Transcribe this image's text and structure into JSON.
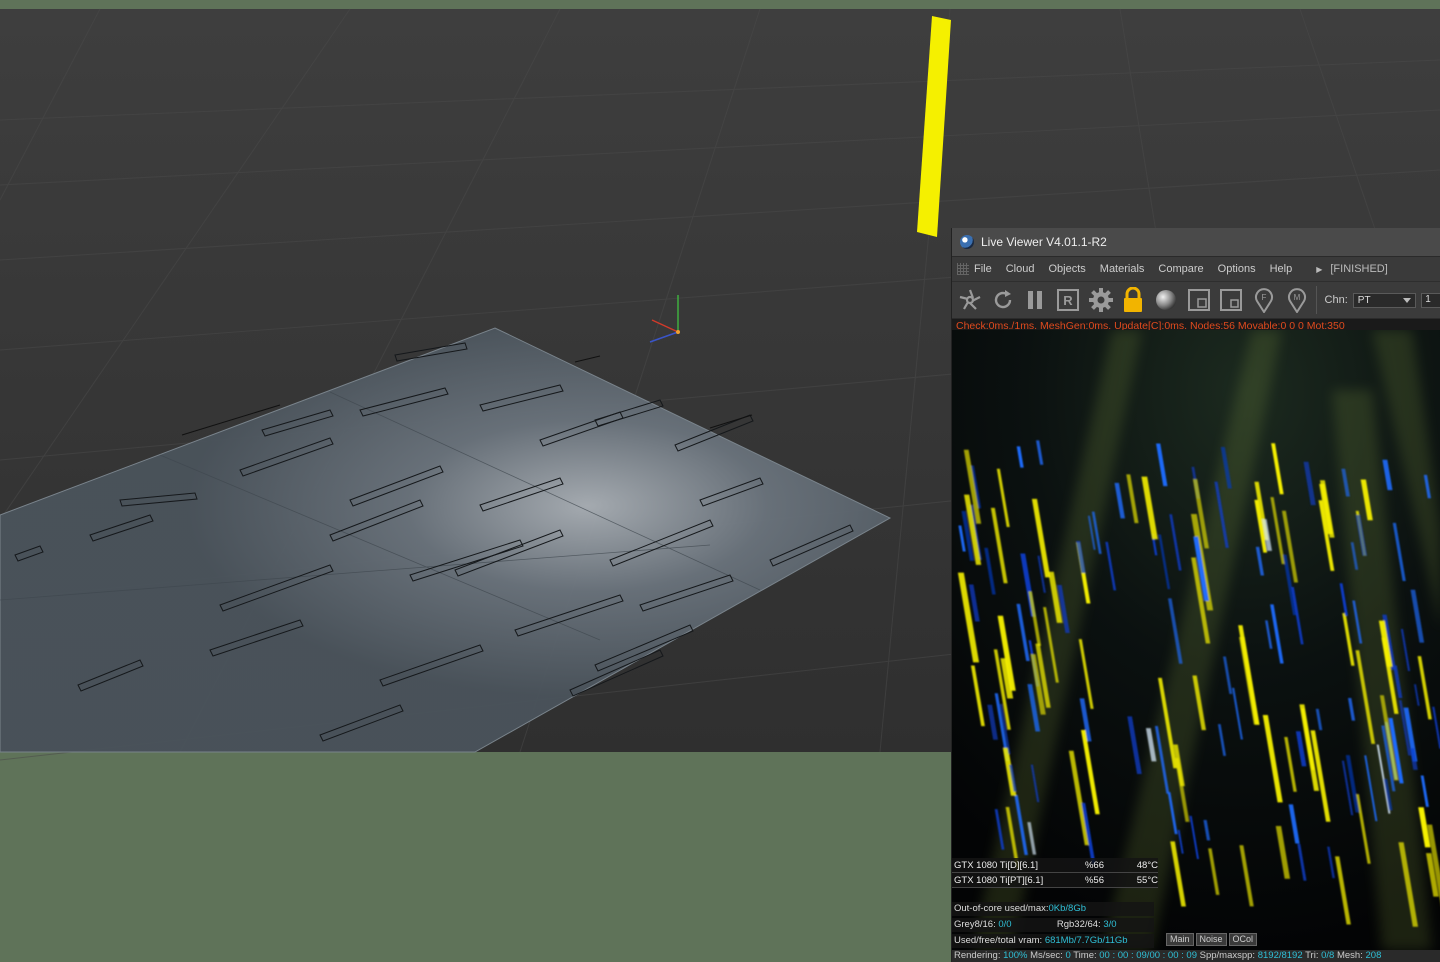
{
  "live_viewer": {
    "title": "Live Viewer V4.01.1-R2",
    "menu": [
      "File",
      "Cloud",
      "Objects",
      "Materials",
      "Compare",
      "Options",
      "Help"
    ],
    "render_state": "[FINISHED]",
    "toolbar": {
      "icons": [
        "send-scene-icon",
        "restart-icon",
        "pause-icon",
        "region-render-icon",
        "settings-gear-icon",
        "lock-icon",
        "material-sphere-icon",
        "clay-mode-icon",
        "subsample-icon",
        "focus-pick-icon",
        "material-pick-icon"
      ],
      "region_label": "R",
      "focus_label": "F",
      "material_label": "M",
      "channel_label": "Chn:",
      "channel_value": "PT",
      "next_value": "1"
    },
    "check_line": "Check:0ms./1ms. MeshGen:0ms. Update[C]:0ms. Nodes:56 Movable:0  0 0 Mot:350",
    "gpus": [
      {
        "name": "GTX 1080 Ti[D][6.1]",
        "load": "%66",
        "temp": "48°C"
      },
      {
        "name": "GTX 1080 Ti[PT][6.1]",
        "load": "%56",
        "temp": "55°C"
      }
    ],
    "out_of_core": {
      "label": "Out-of-core used/max:",
      "value": "0Kb/8Gb"
    },
    "textures": {
      "grey_label": "Grey8/16:",
      "grey_value": "0/0",
      "rgb_label": "Rgb32/64:",
      "rgb_value": "3/0"
    },
    "vram": {
      "label": "Used/free/total vram:",
      "value": "681Mb/7.7Gb/11Gb"
    },
    "view_tabs": [
      "Main",
      "Noise",
      "OCol"
    ],
    "status": {
      "rendering_label": "Rendering:",
      "rendering_value": "100%",
      "ms_label": "Ms/sec:",
      "ms_value": "0",
      "time_label": "Time:",
      "time_value": "00 : 00 : 09/00 : 00 : 09",
      "spp_label": "Spp/maxspp:",
      "spp_value": "8192/8192",
      "tri_label": "Tri:",
      "tri_value": "0/8",
      "mesh_label": "Mesh:",
      "mesh_value": "208"
    }
  },
  "colors": {
    "viewport_bg": "#3b3b3b",
    "outside_bg": "#5f7359",
    "light_yellow": "#f5f000",
    "accent_cyan": "#2fbfd6",
    "check_red": "#e04a1e"
  }
}
